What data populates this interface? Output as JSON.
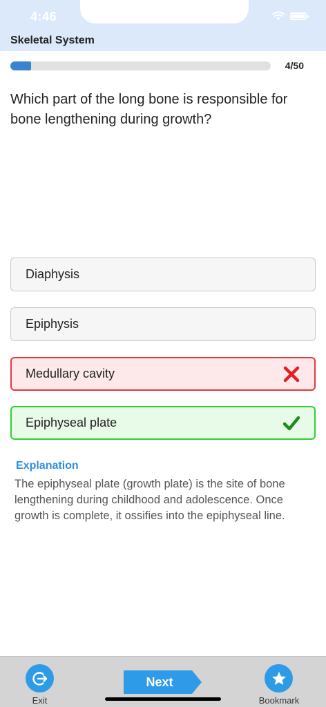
{
  "status_bar": {
    "time": "4:46",
    "icons": [
      "wifi-icon",
      "battery-icon"
    ]
  },
  "header": {
    "title": "Skeletal System"
  },
  "progress": {
    "current": 4,
    "total": 50,
    "label": "4/50",
    "fill_fraction": 0.08
  },
  "question": {
    "text": "Which part of the long bone is responsible for bone lengthening during growth?"
  },
  "options": [
    {
      "label": "Diaphysis",
      "state": "neutral"
    },
    {
      "label": "Epiphysis",
      "state": "neutral"
    },
    {
      "label": "Medullary cavity",
      "state": "wrong",
      "icon": "x-icon"
    },
    {
      "label": "Epiphyseal plate",
      "state": "correct",
      "icon": "checkmark-icon"
    }
  ],
  "explanation": {
    "title": "Explanation",
    "body": "The epiphyseal plate (growth plate) is the site of bone lengthening during childhood and adolescence. Once growth is complete, it ossifies into the epiphyseal line."
  },
  "bottom_bar": {
    "exit_label": "Exit",
    "exit_icon": "exit-icon",
    "next_label": "Next",
    "bookmark_label": "Bookmark",
    "bookmark_icon": "star-icon"
  },
  "colors": {
    "header_bg": "#dbe9fb",
    "accent": "#2e9be8",
    "progress_fill": "#3a84cf",
    "wrong": "#e3393e",
    "correct": "#2fcf2f",
    "explanation_title": "#2f8ee0"
  }
}
